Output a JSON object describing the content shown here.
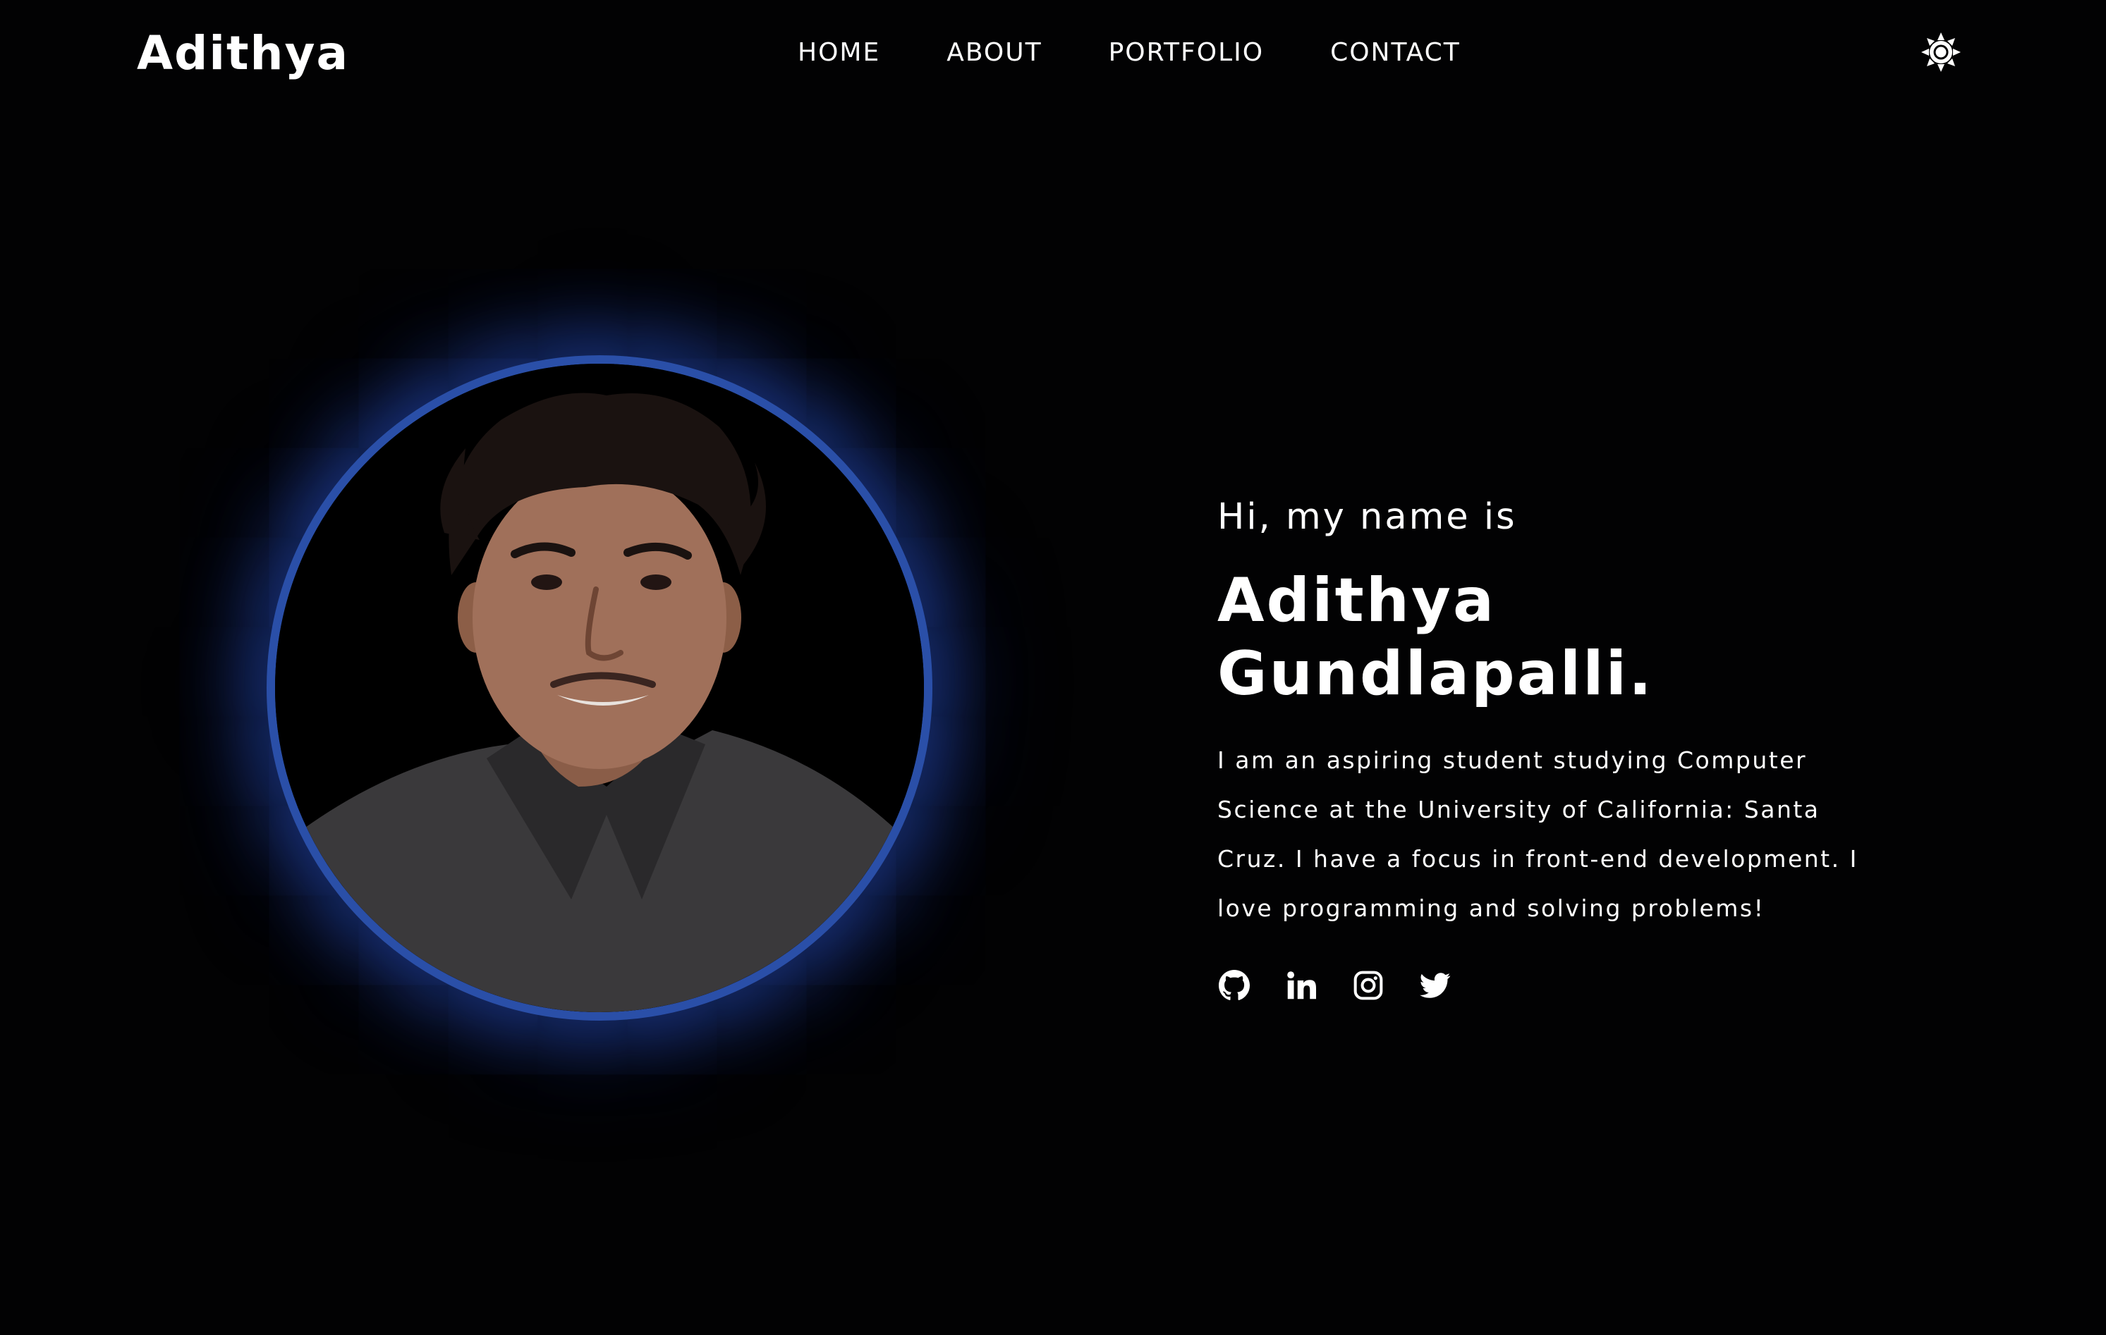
{
  "header": {
    "logo": "Adithya",
    "nav": [
      {
        "label": "HOME"
      },
      {
        "label": "ABOUT"
      },
      {
        "label": "PORTFOLIO"
      },
      {
        "label": "CONTACT"
      }
    ],
    "theme_toggle_icon": "sun-icon"
  },
  "hero": {
    "photo_icon": "profile-photo",
    "greeting": "Hi, my name is",
    "name": "Adithya Gundlapalli.",
    "bio": "I am an aspiring student studying Computer Science at the University of California: Santa Cruz. I have a focus in front-end development. I love programming and solving problems!",
    "socials": [
      {
        "icon": "github-icon"
      },
      {
        "icon": "linkedin-icon"
      },
      {
        "icon": "instagram-icon"
      },
      {
        "icon": "twitter-icon"
      }
    ]
  },
  "colors": {
    "background": "#020203",
    "text": "#ffffff",
    "accent_ring": "#2a4fa8",
    "glow": "#264ebe"
  }
}
